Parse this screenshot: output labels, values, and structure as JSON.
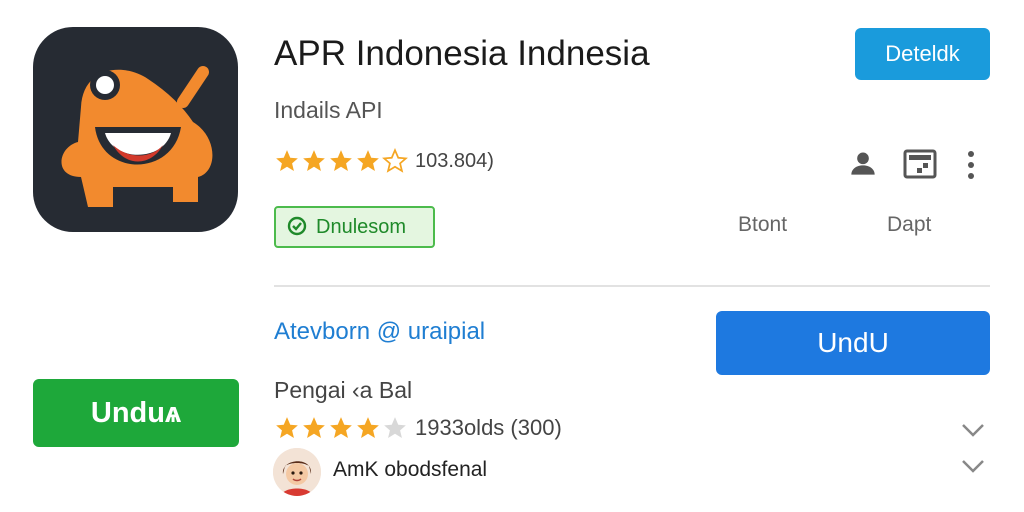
{
  "app": {
    "title": "APR Indonesia Indnesia",
    "developer": "Indails API",
    "rating_count": "103.804)",
    "rating_stars": 4,
    "badge_label": "Dnulesom",
    "detail_button": "Deteldk"
  },
  "tabs": [
    "Btont",
    "Dapt"
  ],
  "section": {
    "link": "Atevborn @ uraipial",
    "download_label": "UndU"
  },
  "sidebar": {
    "download_label": "Unduѧ"
  },
  "item": {
    "name": "Pengai ‹a Bal",
    "rating_stars": 4,
    "rating_count": "1933olds (300)",
    "reviewer": "AmK obodsfenal"
  },
  "icons": [
    "app-icon",
    "person-icon",
    "image-icon",
    "more-vert-icon",
    "chevron-down-icon",
    "star-icon",
    "badge-icon"
  ],
  "colors": {
    "detail_button": "#1a9bdc",
    "download_blue": "#1e79e0",
    "download_green": "#1ea83a",
    "link": "#1f7ed2",
    "star": "#f5a623",
    "app_icon_bg": "#262b33",
    "mascot": "#f28a2e"
  }
}
